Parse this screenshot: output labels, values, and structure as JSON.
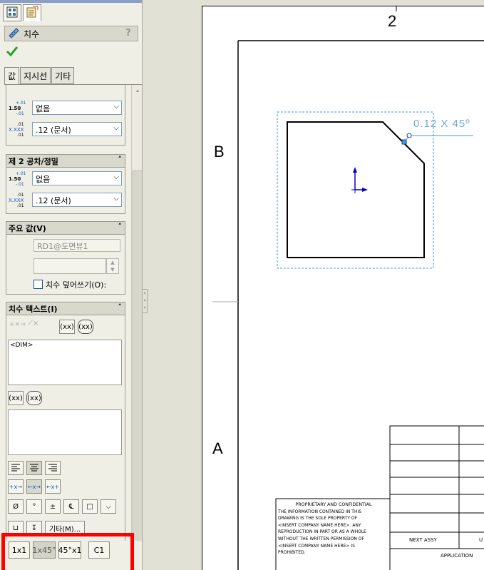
{
  "panel": {
    "title": "치수",
    "help": "?",
    "tabs": [
      {
        "label": "값"
      },
      {
        "label": "지시선"
      },
      {
        "label": "기타"
      }
    ],
    "tolerance_group_1": {
      "tol_value": "없음",
      "precision": ".12 (문서)"
    },
    "tolerance_group_2": {
      "title": "제 2 공차/정밀",
      "tol_value": "없음",
      "precision": ".12 (문서)"
    },
    "primary_value": {
      "title": "주요 값(V)",
      "reference": "RD1@도면뷰1",
      "override_label": "치수 덮어쓰기(O):"
    },
    "dimension_text": {
      "title": "치수 텍스트(I)",
      "text_value": "<DIM>",
      "paren_btn": "(xx)",
      "insp_btn": "(xx)",
      "more_btn": "기타(M)...",
      "symbols": [
        "Ø",
        "°",
        "±",
        "℄",
        "□",
        "⌵"
      ]
    },
    "chamfer_buttons": [
      "1x1",
      "1x45°",
      "45°x1",
      "C1"
    ],
    "icons": [
      "property-manager-icon",
      "configuration-icon",
      "dimension-icon",
      "ok-check-icon",
      "help-icon"
    ]
  },
  "sheet": {
    "zone_top": "2",
    "zone_b": "B",
    "zone_a": "A",
    "dimension_label": "0.12 X 45º",
    "title_block": {
      "prop_heading": "PROPRIETARY AND CONFIDENTIAL",
      "prop_lines": [
        "THE INFORMATION CONTAINED IN THIS",
        "DRAWING IS THE SOLE PROPERTY OF",
        "<INSERT COMPANY NAME HERE>. ANY",
        "REPRODUCTION IN PART OR AS A WHOLE",
        "WITHOUT THE WRITTEN PERMISSION OF",
        "<INSERT COMPANY NAME HERE> IS",
        "PROHIBITED."
      ],
      "next_assy": "NEXT ASSY",
      "used_on": "U",
      "application": "APPLICATION"
    }
  }
}
